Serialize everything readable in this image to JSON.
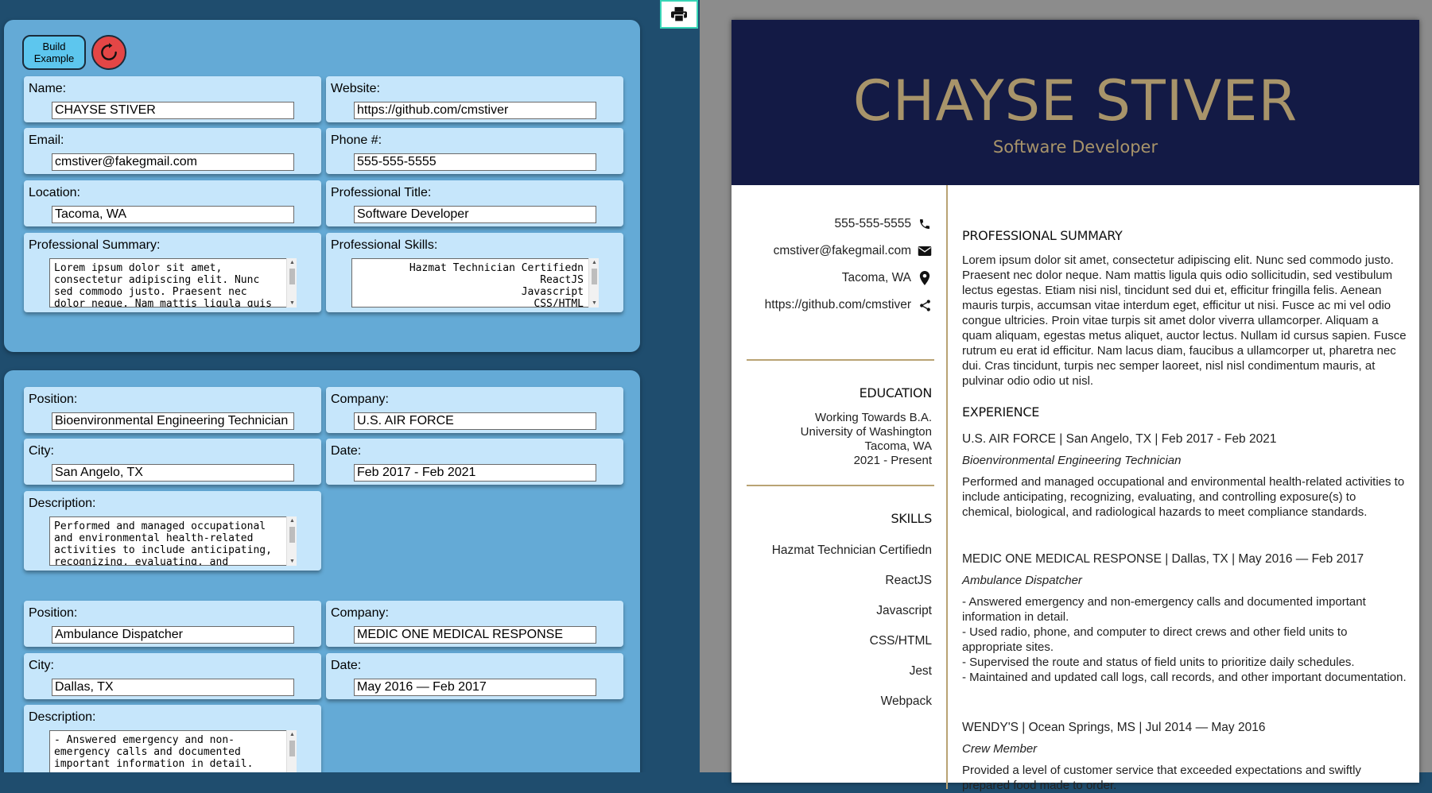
{
  "editor": {
    "build_example_label": "Build Example",
    "general": {
      "name": {
        "label": "Name:",
        "value": "CHAYSE STIVER"
      },
      "website": {
        "label": "Website:",
        "value": "https://github.com/cmstiver"
      },
      "email": {
        "label": "Email:",
        "value": "cmstiver@fakegmail.com"
      },
      "phone": {
        "label": "Phone #:",
        "value": "555-555-5555"
      },
      "location": {
        "label": "Location:",
        "value": "Tacoma, WA"
      },
      "title": {
        "label": "Professional Title:",
        "value": "Software Developer"
      },
      "summary": {
        "label": "Professional Summary:",
        "value": "Lorem ipsum dolor sit amet, consectetur adipiscing elit. Nunc sed commodo justo. Praesent nec dolor neque. Nam mattis ligula quis"
      },
      "skills": {
        "label": "Professional Skills:",
        "value": "Hazmat Technician Certifiedn\nReactJS\nJavascript\nCSS/HTML"
      }
    },
    "experience": [
      {
        "position": {
          "label": "Position:",
          "value": "Bioenvironmental Engineering Technician"
        },
        "company": {
          "label": "Company:",
          "value": "U.S. AIR FORCE"
        },
        "city": {
          "label": "City:",
          "value": "San Angelo, TX"
        },
        "date": {
          "label": "Date:",
          "value": "Feb 2017 - Feb 2021"
        },
        "description": {
          "label": "Description:",
          "value": "Performed and managed occupational and environmental health-related activities to include anticipating, recognizing, evaluating, and"
        }
      },
      {
        "position": {
          "label": "Position:",
          "value": "Ambulance Dispatcher"
        },
        "company": {
          "label": "Company:",
          "value": "MEDIC ONE MEDICAL RESPONSE"
        },
        "city": {
          "label": "City:",
          "value": "Dallas, TX"
        },
        "date": {
          "label": "Date:",
          "value": "May 2016 — Feb 2017"
        },
        "description": {
          "label": "Description:",
          "value": "- Answered emergency and non-emergency calls and documented important information in detail."
        }
      }
    ]
  },
  "print_icon": "printer-icon",
  "resume": {
    "name": "CHAYSE STIVER",
    "title": "Software Developer",
    "contact": {
      "phone": "555-555-5555",
      "email": "cmstiver@fakegmail.com",
      "location": "Tacoma, WA",
      "website": "https://github.com/cmstiver"
    },
    "education": {
      "heading": "EDUCATION",
      "lines": [
        "Working Towards B.A.",
        "University of Washington",
        "Tacoma, WA",
        "2021 - Present"
      ]
    },
    "skills": {
      "heading": "SKILLS",
      "items": [
        "Hazmat Technician Certifiedn",
        "ReactJS",
        "Javascript",
        "CSS/HTML",
        "Jest",
        "Webpack"
      ]
    },
    "summary": {
      "heading": "PROFESSIONAL SUMMARY",
      "text": "Lorem ipsum dolor sit amet, consectetur adipiscing elit. Nunc sed commodo justo. Praesent nec dolor neque. Nam mattis ligula quis odio sollicitudin, sed vestibulum lectus egestas. Etiam nisi nisl, tincidunt sed dui et, efficitur fringilla felis. Aenean mauris turpis, accumsan vitae interdum eget, efficitur ut nisi. Fusce ac mi vel odio congue ultricies. Proin vitae turpis sit amet dolor viverra ullamcorper. Aliquam a quam aliquam, egestas metus aliquet, auctor lectus. Nullam id cursus sapien. Fusce rutrum eu erat id efficitur. Nam lacus diam, faucibus a ullamcorper ut, pharetra nec dui. Cras tincidunt, turpis nec semper laoreet, nisl nisl condimentum mauris, at pulvinar odio odio ut nisl."
    },
    "experience": {
      "heading": "EXPERIENCE",
      "jobs": [
        {
          "header": "U.S. AIR FORCE | San Angelo, TX | Feb 2017 - Feb 2021",
          "position": "Bioenvironmental Engineering Technician",
          "description": "Performed and managed occupational and environmental health-related activities to include anticipating, recognizing, evaluating, and controlling exposure(s) to chemical, biological, and radiological hazards to meet compliance standards."
        },
        {
          "header": "MEDIC ONE MEDICAL RESPONSE | Dallas, TX | May 2016 — Feb 2017",
          "position": "Ambulance Dispatcher",
          "description": "- Answered emergency and non-emergency calls and documented important information in detail.\n- Used radio, phone, and computer to direct crews and other field units to appropriate sites.\n- Supervised the route and status of field units to prioritize daily schedules.\n- Maintained and updated call logs, call records, and other important documentation."
        },
        {
          "header": "WENDY'S | Ocean Springs, MS | Jul 2014 — May 2016",
          "position": "Crew Member",
          "description": "Provided a level of customer service that exceeded expectations and swiftly prepared food made to order."
        }
      ]
    }
  },
  "colors": {
    "page_bg": "#1f4d6e",
    "panel_bg": "#64aad6",
    "field_bg": "#c6e6fb",
    "resume_header_bg": "#131a45",
    "gold": "#a8946a"
  }
}
